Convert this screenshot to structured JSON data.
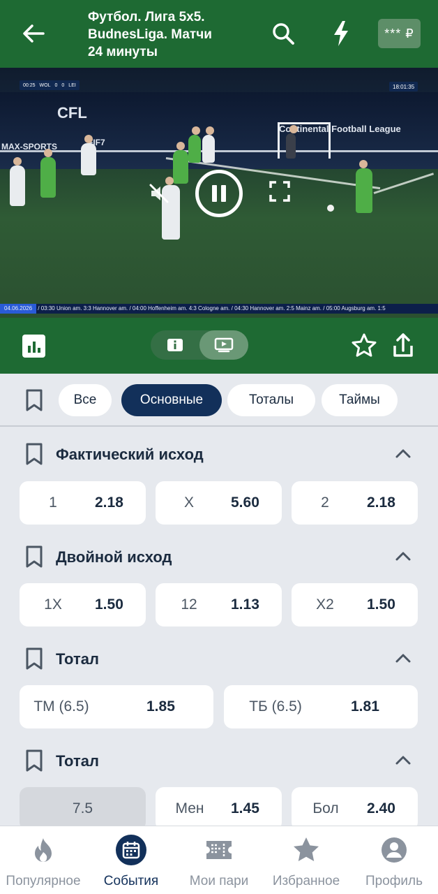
{
  "header": {
    "title_line1": "Футбол. Лига 5x5.",
    "title_line2": "BudnesLiga. Матчи",
    "title_line3": "24 минуты",
    "balance": "*** ₽"
  },
  "video": {
    "score_time": "00:25",
    "team_home": "WOL",
    "score_home": "0",
    "score_away": "0",
    "team_away": "LEI",
    "clock": "18:01:35",
    "wall_text_1": "CFL",
    "wall_text_2": "Continental Football League",
    "wall_text_3": "MAX-SPORTS",
    "wall_text_4": "FIF7",
    "ticker_date": "04.06.2026",
    "ticker_text": "/ 03:30 Union am. 3:3 Hannover am. / 04:00 Hoffenheim am. 4:3 Cologne am. / 04:30 Hannover am. 2:5 Mainz am. / 05:00 Augsburg am. 1:5"
  },
  "filters": {
    "chips": [
      "Все",
      "Основные",
      "Тоталы",
      "Таймы"
    ],
    "active": "Основные"
  },
  "markets": [
    {
      "title": "Фактический исход",
      "outcomes": [
        {
          "label": "1",
          "odds": "2.18"
        },
        {
          "label": "X",
          "odds": "5.60"
        },
        {
          "label": "2",
          "odds": "2.18"
        }
      ]
    },
    {
      "title": "Двойной исход",
      "outcomes": [
        {
          "label": "1X",
          "odds": "1.50"
        },
        {
          "label": "12",
          "odds": "1.13"
        },
        {
          "label": "X2",
          "odds": "1.50"
        }
      ]
    },
    {
      "title": "Тотал",
      "outcomes": [
        {
          "label": "ТМ (6.5)",
          "odds": "1.85"
        },
        {
          "label": "ТБ (6.5)",
          "odds": "1.81"
        }
      ]
    },
    {
      "title": "Тотал",
      "line": "7.5",
      "outcomes": [
        {
          "label": "Мен",
          "odds": "1.45"
        },
        {
          "label": "Бол",
          "odds": "2.40"
        }
      ]
    }
  ],
  "bottom_nav": {
    "items": [
      {
        "label": "Популярное",
        "icon": "flame-icon"
      },
      {
        "label": "События",
        "icon": "calendar-icon"
      },
      {
        "label": "Мои пари",
        "icon": "ticket-icon"
      },
      {
        "label": "Избранное",
        "icon": "star-icon"
      },
      {
        "label": "Профиль",
        "icon": "profile-icon"
      }
    ],
    "active": "События"
  },
  "colors": {
    "brand_green": "#1e6a33",
    "navy": "#12305a",
    "background": "#e6e9ee"
  }
}
